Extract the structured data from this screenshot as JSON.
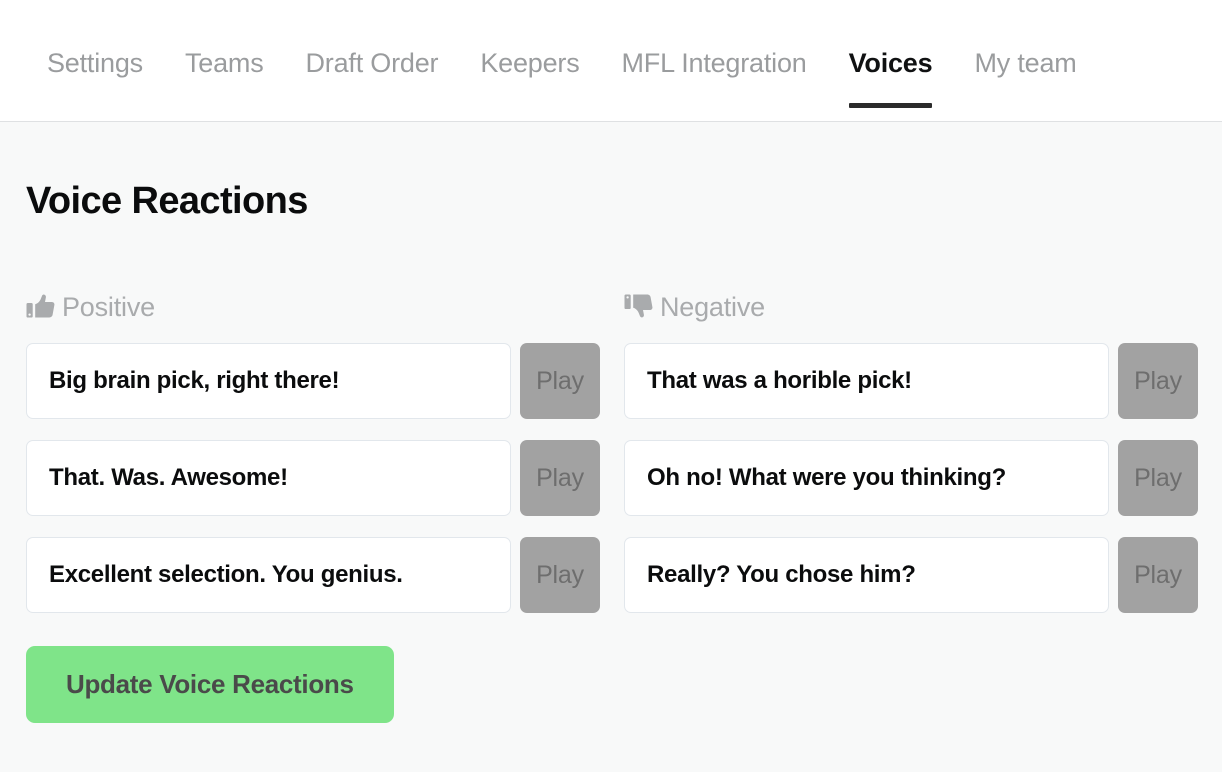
{
  "tabs": [
    {
      "label": "Settings",
      "active": false
    },
    {
      "label": "Teams",
      "active": false
    },
    {
      "label": "Draft Order",
      "active": false
    },
    {
      "label": "Keepers",
      "active": false
    },
    {
      "label": "MFL Integration",
      "active": false
    },
    {
      "label": "Voices",
      "active": true
    },
    {
      "label": "My team",
      "active": false
    }
  ],
  "page": {
    "title": "Voice Reactions"
  },
  "sections": [
    {
      "id": "positive",
      "label": "Positive",
      "icon": "thumbs-up-icon",
      "rows": [
        {
          "value": "Big brain pick, right there!",
          "play_label": "Play"
        },
        {
          "value": "That. Was. Awesome!",
          "play_label": "Play"
        },
        {
          "value": "Excellent selection. You genius.",
          "play_label": "Play"
        }
      ]
    },
    {
      "id": "negative",
      "label": "Negative",
      "icon": "thumbs-down-icon",
      "rows": [
        {
          "value": "That was a horible pick!",
          "play_label": "Play"
        },
        {
          "value": "Oh no! What were you thinking?",
          "play_label": "Play"
        },
        {
          "value": "Really? You chose him?",
          "play_label": "Play"
        }
      ]
    }
  ],
  "actions": {
    "update_label": "Update Voice Reactions"
  },
  "colors": {
    "page_background": "#f8f9f9",
    "tabbar_background": "#ffffff",
    "tab_inactive_text": "#9a9c9e",
    "tab_active_text": "#101112",
    "tab_active_underline": "#2b2b2b",
    "title_text": "#0b0c0d",
    "section_label_text": "#a9abad",
    "section_icon": "#a9abad",
    "input_border": "#e2e7ec",
    "input_background": "#ffffff",
    "input_text": "#0b0c0d",
    "play_button_background": "#a2a2a2",
    "play_button_text": "#6e6e6e",
    "update_button_background": "#7fe489",
    "update_button_text": "#4a4a4a"
  }
}
